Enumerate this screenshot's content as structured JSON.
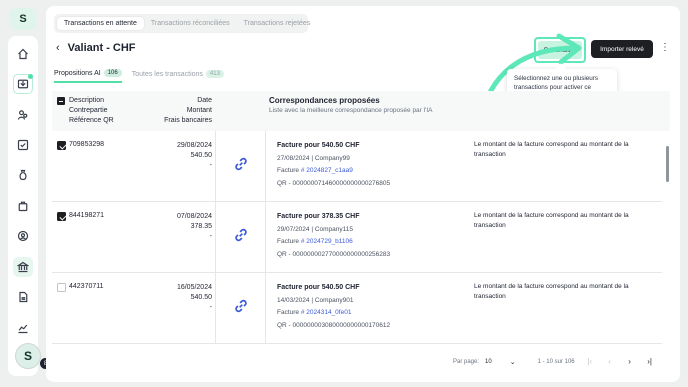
{
  "sidebar": {
    "logo": "S",
    "items": [
      {
        "icon": "home-icon"
      },
      {
        "icon": "inbox-icon",
        "boxed": true,
        "dot": true
      },
      {
        "icon": "users-icon"
      },
      {
        "icon": "checklist-icon"
      },
      {
        "icon": "money-bag-icon"
      },
      {
        "icon": "bag-icon"
      },
      {
        "icon": "user-circle-icon"
      },
      {
        "icon": "bank-icon",
        "active": true
      },
      {
        "icon": "document-icon"
      },
      {
        "icon": "chart-icon"
      }
    ],
    "avatar_initial": "S",
    "avatar_badge": "8"
  },
  "top_tabs": [
    "Transactions en attente",
    "Transactions réconciliées",
    "Transactions rejetées"
  ],
  "header": {
    "title": "Valiant - CHF",
    "reconcile_label": "Réconcilier",
    "import_label": "Importer relevé"
  },
  "tooltip": "Sélectionnez une ou plusieurs transactions pour activer ce bouton",
  "sub_tabs": [
    {
      "label": "Propositions AI",
      "count": "106"
    },
    {
      "label": "Toutes les transactions",
      "count": "413"
    }
  ],
  "table": {
    "col1": [
      "Description",
      "Contrepartie",
      "Référence QR"
    ],
    "col2": [
      "Date",
      "Montant",
      "Frais bancaires"
    ],
    "col3_title": "Correspondances proposées",
    "col3_sub": "Liste avec la meilleure correspondance proposée par l'IA",
    "rows": [
      {
        "ref": "709853298",
        "checked": true,
        "date": "29/08/2024",
        "amount": "540.50",
        "fees": "-",
        "match_title": "Facture pour 540.50 CHF",
        "match_line1": "27/08/2024 | Company99",
        "match_invoice_prefix": "Facture ",
        "match_invoice": "# 2024827_c1aa9",
        "match_qr": "QR - 000000071460000000000276805",
        "reason": "Le montant de la facture correspond au montant de la transaction"
      },
      {
        "ref": "844198271",
        "checked": true,
        "date": "07/08/2024",
        "amount": "378.35",
        "fees": "-",
        "match_title": "Facture pour 378.35 CHF",
        "match_line1": "29/07/2024 | Company115",
        "match_invoice_prefix": "Facture ",
        "match_invoice": "# 2024729_b1106",
        "match_qr": "QR - 000000002770000000000256283",
        "reason": "Le montant de la facture correspond au montant de la transaction"
      },
      {
        "ref": "442370711",
        "checked": false,
        "date": "16/05/2024",
        "amount": "540.50",
        "fees": "-",
        "match_title": "Facture pour 540.50 CHF",
        "match_line1": "14/03/2024 | Company901",
        "match_invoice_prefix": "Facture ",
        "match_invoice": "# 2024314_0fe01",
        "match_qr": "QR - 000000003080000000000170612",
        "reason": "Le montant de la facture correspond au montant de la transaction"
      }
    ]
  },
  "pagination": {
    "per_page_label": "Par page:",
    "per_page_value": "10",
    "range": "1 - 10 sur 106"
  },
  "colors": {
    "accent": "#4ee0a8",
    "link": "#3b5bd6",
    "dark_button": "#1d1f23"
  }
}
